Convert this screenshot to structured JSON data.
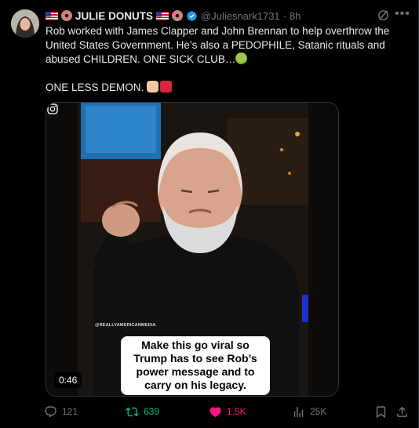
{
  "author": {
    "display_name": "JULIE DONUTS",
    "handle": "@Juliesnark1731",
    "time_sep": "·",
    "time": "8h",
    "verified": true
  },
  "tweet": {
    "paragraph1": "Rob worked with James Clapper and John Brennan to help overthrow the United States Government. He’s also a PEDOPHILE, Satanic rituals and abused CHILDREN. ONE SICK CLUB…",
    "paragraph2": "ONE LESS DEMON."
  },
  "media": {
    "instagram_handle": "@REALLYAMERICANMEDIA",
    "caption": "Make this go viral so Trump has to see Rob’s power message and to carry on his legacy.",
    "duration": "0:46"
  },
  "actions": {
    "replies": "121",
    "reposts": "639",
    "likes": "1.5K",
    "views": "25K"
  },
  "colors": {
    "background": "#000000",
    "text": "#e7e9ea",
    "secondary": "#71767b",
    "repost_active": "#00ba7c",
    "like_active": "#f91880",
    "verified": "#1d9bf0"
  },
  "icons": [
    "verified-badge-icon",
    "grok-icon",
    "more-icon",
    "instagram-icon",
    "reply-icon",
    "repost-icon",
    "like-icon",
    "views-icon",
    "bookmark-icon",
    "share-icon"
  ]
}
